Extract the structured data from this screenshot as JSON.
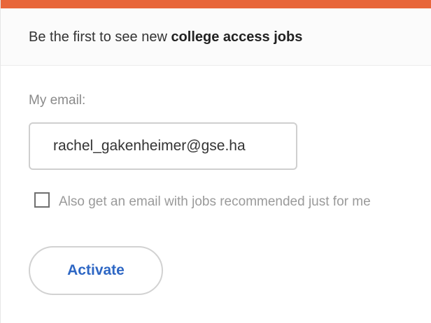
{
  "header": {
    "text_prefix": "Be the first to see new ",
    "text_bold": "college access jobs"
  },
  "form": {
    "email_label": "My email:",
    "email_value": "rachel_gakenheimer@gse.ha",
    "checkbox_label": "Also get an email with jobs recommended just for me",
    "checkbox_checked": false,
    "submit_label": "Activate"
  },
  "colors": {
    "accent_bar": "#e8663a",
    "button_text": "#2e67c4"
  }
}
